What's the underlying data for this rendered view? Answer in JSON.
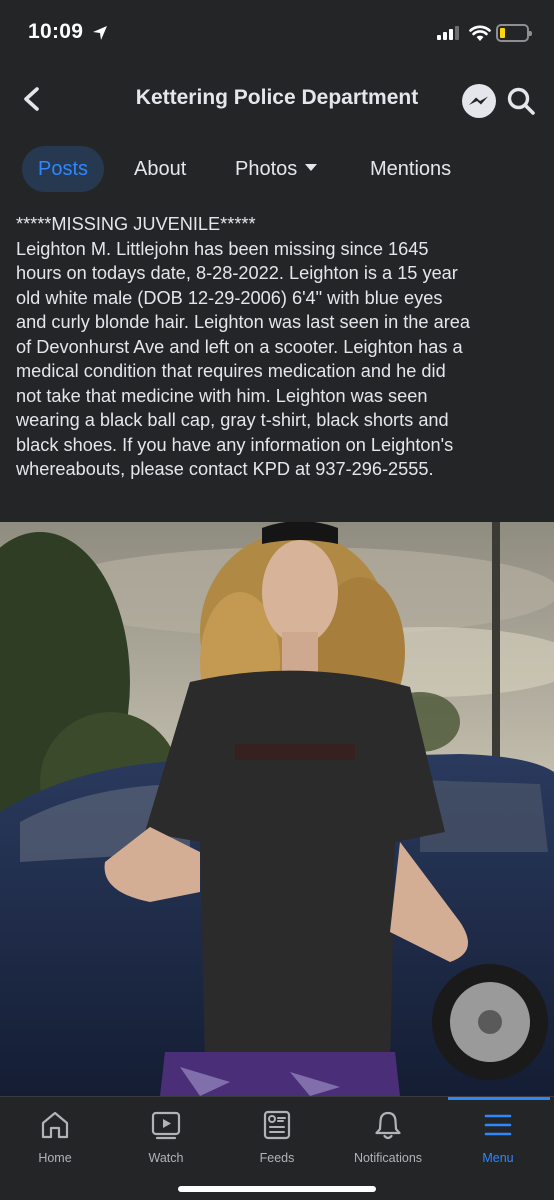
{
  "status_bar": {
    "time": "10:09",
    "battery_level": 0.15,
    "battery_color": "#ffd60a"
  },
  "header": {
    "title": "Kettering Police Department",
    "icons": [
      "back-chevron-icon",
      "messenger-icon",
      "search-icon"
    ]
  },
  "tabs": [
    {
      "label": "Posts",
      "active": true
    },
    {
      "label": "About",
      "active": false
    },
    {
      "label": "Photos",
      "active": false,
      "has_dropdown": true
    },
    {
      "label": "Mentions",
      "active": false
    }
  ],
  "post": {
    "lines": [
      "*****MISSING JUVENILE*****",
      "Leighton M. Littlejohn has been missing since 1645",
      "hours on todays date, 8-28-2022. Leighton is a 15 year",
      "old white male (DOB 12-29-2006) 6'4\" with blue eyes",
      "and curly blonde hair. Leighton was last seen in the area",
      "of Devonhurst Ave and left on a scooter. Leighton has a",
      "medical condition that requires medication and he did",
      "not take that medicine with him. Leighton was seen",
      "wearing a black ball cap, gray t-shirt, black shorts and",
      "black shoes. If you have any information on Leighton's",
      "whereabouts, please contact KPD at 937-296-2555."
    ]
  },
  "bottom_nav": {
    "items": [
      {
        "label": "Home",
        "icon": "home-icon",
        "active": false
      },
      {
        "label": "Watch",
        "icon": "watch-icon",
        "active": false
      },
      {
        "label": "Feeds",
        "icon": "feeds-icon",
        "active": false
      },
      {
        "label": "Notifications",
        "icon": "bell-icon",
        "active": false
      },
      {
        "label": "Menu",
        "icon": "menu-icon",
        "active": true
      }
    ]
  },
  "colors": {
    "background": "#242526",
    "accent": "#2d88ff",
    "text": "#e4e6eb",
    "secondary_text": "#b0b3b8"
  }
}
